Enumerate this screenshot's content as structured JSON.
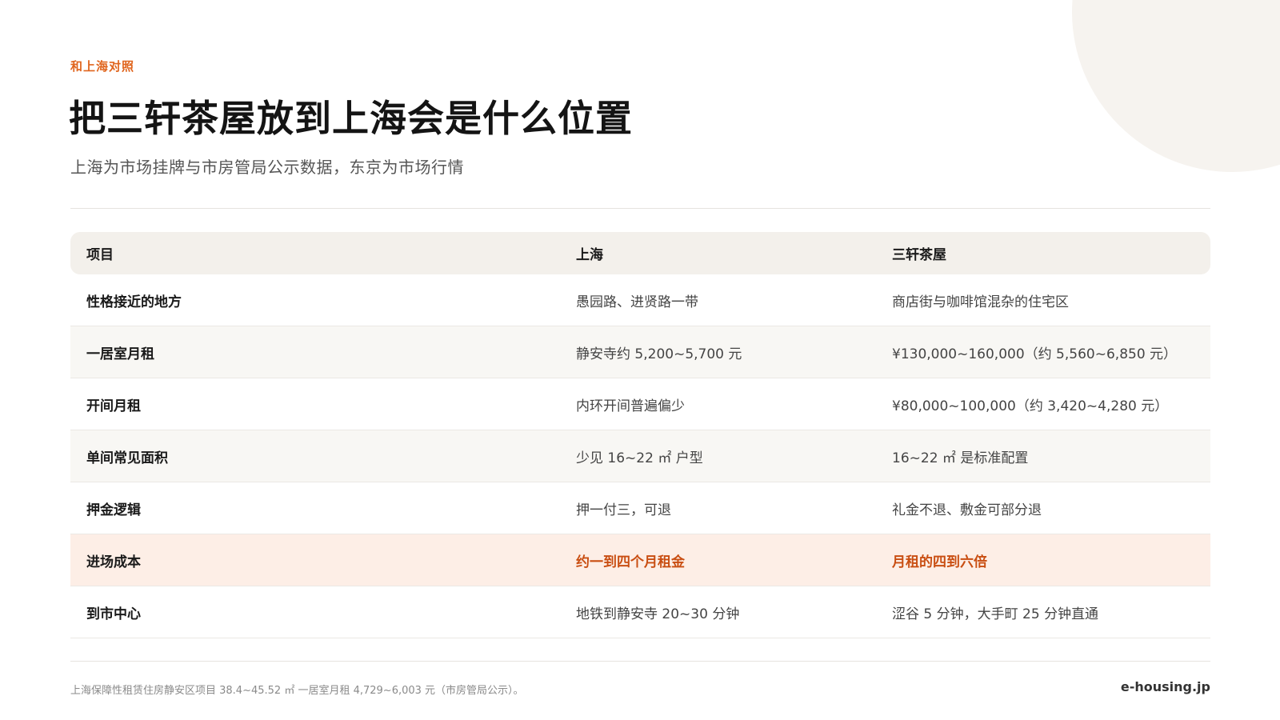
{
  "header": {
    "eyebrow": "和上海对照",
    "title": "把三轩茶屋放到上海会是什么位置",
    "subtitle": "上海为市场挂牌与市房管局公示数据，东京为市场行情"
  },
  "table": {
    "columns": [
      "项目",
      "上海",
      "三轩茶屋"
    ],
    "rows": [
      {
        "item": "性格接近的地方",
        "shanghai": "愚园路、进贤路一带",
        "sangenjaya": "商店街与咖啡馆混杂的住宅区"
      },
      {
        "item": "一居室月租",
        "shanghai": "静安寺约 5,200~5,700 元",
        "sangenjaya": "¥130,000~160,000（约 5,560~6,850 元）"
      },
      {
        "item": "开间月租",
        "shanghai": "内环开间普遍偏少",
        "sangenjaya": "¥80,000~100,000（约 3,420~4,280 元）"
      },
      {
        "item": "单间常见面积",
        "shanghai": "少见 16~22 ㎡ 户型",
        "sangenjaya": "16~22 ㎡ 是标准配置"
      },
      {
        "item": "押金逻辑",
        "shanghai": "押一付三，可退",
        "sangenjaya": "礼金不退、敷金可部分退"
      },
      {
        "item": "进场成本",
        "shanghai": "约一到四个月租金",
        "sangenjaya": "月租的四到六倍"
      },
      {
        "item": "到市中心",
        "shanghai": "地铁到静安寺 20~30 分钟",
        "sangenjaya": "涩谷 5 分钟，大手町 25 分钟直通"
      }
    ]
  },
  "footer": {
    "note": "上海保障性租赁住房静安区项目 38.4~45.52 ㎡ 一居室月租 4,729~6,003 元（市房管局公示）。",
    "brand": "e-housing.jp"
  },
  "colors": {
    "accent": "#e0651e",
    "highlight_text": "#c94e12",
    "highlight_row_bg": "#fdeee6",
    "header_bg": "#f3f0eb"
  }
}
